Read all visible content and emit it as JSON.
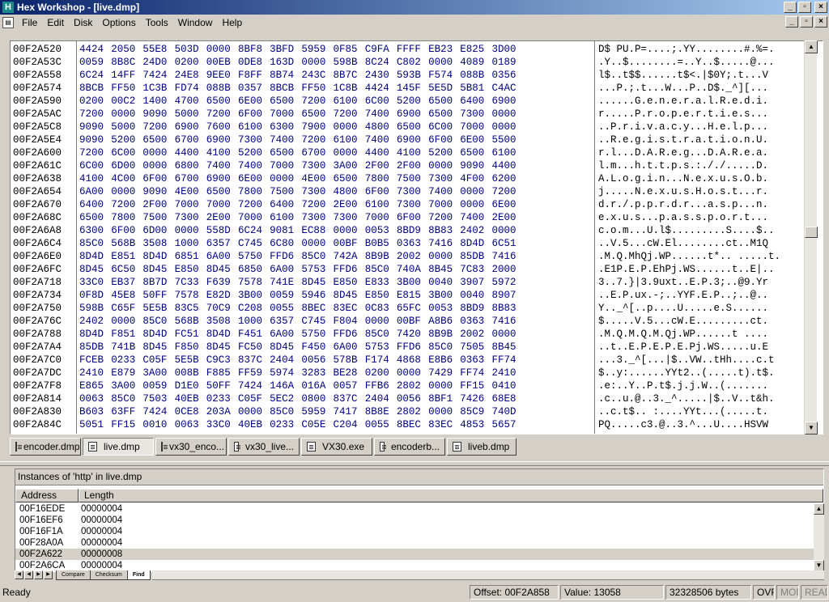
{
  "window": {
    "title": "Hex Workshop - [live.dmp]",
    "app_icon_letter": "H",
    "buttons": {
      "minimize": "_",
      "maximize": "▫",
      "close": "×"
    }
  },
  "menu": {
    "items": [
      "File",
      "Edit",
      "Disk",
      "Options",
      "Tools",
      "Window",
      "Help"
    ]
  },
  "hex_view": {
    "rows": [
      {
        "addr": "00F2A520",
        "hex": [
          "4424",
          "2050",
          "55E8",
          "503D",
          "0000",
          "8BF8",
          "3BFD",
          "5959",
          "0F85",
          "C9FA",
          "FFFF",
          "EB23",
          "E825",
          "3D00"
        ],
        "ascii": "D$ PU.P=....;.YY........#.%=."
      },
      {
        "addr": "00F2A53C",
        "hex": [
          "0059",
          "8B8C",
          "24D0",
          "0200",
          "00EB",
          "0DE8",
          "163D",
          "0000",
          "598B",
          "8C24",
          "C802",
          "0000",
          "4089",
          "0189"
        ],
        "ascii": ".Y..$........=..Y..$.....@..."
      },
      {
        "addr": "00F2A558",
        "hex": [
          "6C24",
          "14FF",
          "7424",
          "24E8",
          "9EE0",
          "F8FF",
          "8B74",
          "243C",
          "8B7C",
          "2430",
          "593B",
          "F574",
          "088B",
          "0356"
        ],
        "ascii": "l$..t$$......t$<.|$0Y;.t...V"
      },
      {
        "addr": "00F2A574",
        "hex": [
          "8BCB",
          "FF50",
          "1C3B",
          "FD74",
          "088B",
          "0357",
          "8BCB",
          "FF50",
          "1C8B",
          "4424",
          "145F",
          "5E5D",
          "5B81",
          "C4AC"
        ],
        "ascii": "...P.;.t...W...P..D$._^][..."
      },
      {
        "addr": "00F2A590",
        "hex": [
          "0200",
          "00C2",
          "1400",
          "4700",
          "6500",
          "6E00",
          "6500",
          "7200",
          "6100",
          "6C00",
          "5200",
          "6500",
          "6400",
          "6900"
        ],
        "ascii": "......G.e.n.e.r.a.l.R.e.d.i."
      },
      {
        "addr": "00F2A5AC",
        "hex": [
          "7200",
          "0000",
          "9090",
          "5000",
          "7200",
          "6F00",
          "7000",
          "6500",
          "7200",
          "7400",
          "6900",
          "6500",
          "7300",
          "0000"
        ],
        "ascii": "r.....P.r.o.p.e.r.t.i.e.s..."
      },
      {
        "addr": "00F2A5C8",
        "hex": [
          "9090",
          "5000",
          "7200",
          "6900",
          "7600",
          "6100",
          "6300",
          "7900",
          "0000",
          "4800",
          "6500",
          "6C00",
          "7000",
          "0000"
        ],
        "ascii": "..P.r.i.v.a.c.y...H.e.l.p..."
      },
      {
        "addr": "00F2A5E4",
        "hex": [
          "9090",
          "5200",
          "6500",
          "6700",
          "6900",
          "7300",
          "7400",
          "7200",
          "6100",
          "7400",
          "6900",
          "6F00",
          "6E00",
          "5500"
        ],
        "ascii": "..R.e.g.i.s.t.r.a.t.i.o.n.U."
      },
      {
        "addr": "00F2A600",
        "hex": [
          "7200",
          "6C00",
          "0000",
          "4400",
          "4100",
          "5200",
          "6500",
          "6700",
          "0000",
          "4400",
          "4100",
          "5200",
          "6500",
          "6100"
        ],
        "ascii": "r.l...D.A.R.e.g...D.A.R.e.a."
      },
      {
        "addr": "00F2A61C",
        "hex": [
          "6C00",
          "6D00",
          "0000",
          "6800",
          "7400",
          "7400",
          "7000",
          "7300",
          "3A00",
          "2F00",
          "2F00",
          "0000",
          "9090",
          "4400"
        ],
        "ascii": "l.m...h.t.t.p.s.:././.....D."
      },
      {
        "addr": "00F2A638",
        "hex": [
          "4100",
          "4C00",
          "6F00",
          "6700",
          "6900",
          "6E00",
          "0000",
          "4E00",
          "6500",
          "7800",
          "7500",
          "7300",
          "4F00",
          "6200"
        ],
        "ascii": "A.L.o.g.i.n...N.e.x.u.s.O.b."
      },
      {
        "addr": "00F2A654",
        "hex": [
          "6A00",
          "0000",
          "9090",
          "4E00",
          "6500",
          "7800",
          "7500",
          "7300",
          "4800",
          "6F00",
          "7300",
          "7400",
          "0000",
          "7200"
        ],
        "ascii": "j.....N.e.x.u.s.H.o.s.t...r."
      },
      {
        "addr": "00F2A670",
        "hex": [
          "6400",
          "7200",
          "2F00",
          "7000",
          "7000",
          "7200",
          "6400",
          "7200",
          "2E00",
          "6100",
          "7300",
          "7000",
          "0000",
          "6E00"
        ],
        "ascii": "d.r./.p.p.r.d.r...a.s.p...n."
      },
      {
        "addr": "00F2A68C",
        "hex": [
          "6500",
          "7800",
          "7500",
          "7300",
          "2E00",
          "7000",
          "6100",
          "7300",
          "7300",
          "7000",
          "6F00",
          "7200",
          "7400",
          "2E00"
        ],
        "ascii": "e.x.u.s...p.a.s.s.p.o.r.t..."
      },
      {
        "addr": "00F2A6A8",
        "hex": [
          "6300",
          "6F00",
          "6D00",
          "0000",
          "558D",
          "6C24",
          "9081",
          "EC88",
          "0000",
          "0053",
          "8BD9",
          "8B83",
          "2402",
          "0000"
        ],
        "ascii": "c.o.m...U.l$.........S....$.."
      },
      {
        "addr": "00F2A6C4",
        "hex": [
          "85C0",
          "568B",
          "3508",
          "1000",
          "6357",
          "C745",
          "6C80",
          "0000",
          "00BF",
          "B0B5",
          "0363",
          "7416",
          "8D4D",
          "6C51"
        ],
        "ascii": "..V.5...cW.El........ct..M1Q"
      },
      {
        "addr": "00F2A6E0",
        "hex": [
          "8D4D",
          "E851",
          "8D4D",
          "6851",
          "6A00",
          "5750",
          "FFD6",
          "85C0",
          "742A",
          "8B9B",
          "2002",
          "0000",
          "85DB",
          "7416"
        ],
        "ascii": ".M.Q.MhQj.WP......t*.. .....t."
      },
      {
        "addr": "00F2A6FC",
        "hex": [
          "8D45",
          "6C50",
          "8D45",
          "E850",
          "8D45",
          "6850",
          "6A00",
          "5753",
          "FFD6",
          "85C0",
          "740A",
          "8B45",
          "7C83",
          "2000"
        ],
        "ascii": ".E1P.E.P.EhPj.WS......t..E|.. "
      },
      {
        "addr": "00F2A718",
        "hex": [
          "33C0",
          "EB37",
          "8B7D",
          "7C33",
          "F639",
          "7578",
          "741E",
          "8D45",
          "E850",
          "E833",
          "3B00",
          "0040",
          "3907",
          "5972"
        ],
        "ascii": "3..7.}|3.9uxt..E.P.3;..@9.Yr"
      },
      {
        "addr": "00F2A734",
        "hex": [
          "0F8D",
          "45E8",
          "50FF",
          "7578",
          "E82D",
          "3B00",
          "0059",
          "5946",
          "8D45",
          "E850",
          "E815",
          "3B00",
          "0040",
          "8907"
        ],
        "ascii": "..E.P.ux.-;..YYF.E.P..;..@.."
      },
      {
        "addr": "00F2A750",
        "hex": [
          "598B",
          "C65F",
          "5E5B",
          "83C5",
          "70C9",
          "C208",
          "0055",
          "8BEC",
          "83EC",
          "0C83",
          "65FC",
          "0053",
          "8BD9",
          "8B83"
        ],
        "ascii": "Y.._^[..p....U.....e.S......"
      },
      {
        "addr": "00F2A76C",
        "hex": [
          "2402",
          "0000",
          "85C0",
          "568B",
          "3508",
          "1000",
          "6357",
          "C745",
          "F804",
          "0000",
          "00BF",
          "A8B6",
          "0363",
          "7416"
        ],
        "ascii": "$.....V.5...cW.E.........ct."
      },
      {
        "addr": "00F2A788",
        "hex": [
          "8D4D",
          "F851",
          "8D4D",
          "FC51",
          "8D4D",
          "F451",
          "6A00",
          "5750",
          "FFD6",
          "85C0",
          "7420",
          "8B9B",
          "2002",
          "0000"
        ],
        "ascii": ".M.Q.M.Q.M.Qj.WP......t ...."
      },
      {
        "addr": "00F2A7A4",
        "hex": [
          "85DB",
          "741B",
          "8D45",
          "F850",
          "8D45",
          "FC50",
          "8D45",
          "F450",
          "6A00",
          "5753",
          "FFD6",
          "85C0",
          "7505",
          "8B45"
        ],
        "ascii": "..t..E.P.E.P.E.Pj.WS.....u.E"
      },
      {
        "addr": "00F2A7C0",
        "hex": [
          "FCEB",
          "0233",
          "C05F",
          "5E5B",
          "C9C3",
          "837C",
          "2404",
          "0056",
          "578B",
          "F174",
          "4868",
          "E8B6",
          "0363",
          "FF74"
        ],
        "ascii": "...3._^[...|$..VW..tHh....c.t"
      },
      {
        "addr": "00F2A7DC",
        "hex": [
          "2410",
          "E879",
          "3A00",
          "008B",
          "F885",
          "FF59",
          "5974",
          "3283",
          "BE28",
          "0200",
          "0000",
          "7429",
          "FF74",
          "2410"
        ],
        "ascii": "$..y:......YYt2..(.....t).t$."
      },
      {
        "addr": "00F2A7F8",
        "hex": [
          "E865",
          "3A00",
          "0059",
          "D1E0",
          "50FF",
          "7424",
          "146A",
          "016A",
          "0057",
          "FFB6",
          "2802",
          "0000",
          "FF15",
          "0410"
        ],
        "ascii": ".e:..Y..P.t$.j.j.W..(......."
      },
      {
        "addr": "00F2A814",
        "hex": [
          "0063",
          "85C0",
          "7503",
          "40EB",
          "0233",
          "C05F",
          "5EC2",
          "0800",
          "837C",
          "2404",
          "0056",
          "8BF1",
          "7426",
          "68E8"
        ],
        "ascii": ".c..u.@..3._^.....|$..V..t&h."
      },
      {
        "addr": "00F2A830",
        "hex": [
          "B603",
          "63FF",
          "7424",
          "0CE8",
          "203A",
          "0000",
          "85C0",
          "5959",
          "7417",
          "8B8E",
          "2802",
          "0000",
          "85C9",
          "740D"
        ],
        "ascii": "..c.t$.. :....YYt...(.....t."
      },
      {
        "addr": "00F2A84C",
        "hex": [
          "5051",
          "FF15",
          "0010",
          "0063",
          "33C0",
          "40EB",
          "0233",
          "C05E",
          "C204",
          "0055",
          "8BEC",
          "83EC",
          "4853",
          "5657"
        ],
        "ascii": "PQ.....c3.@..3.^...U....HSVW"
      }
    ]
  },
  "doc_tabs": [
    {
      "label": "encoder.dmp",
      "active": false
    },
    {
      "label": "live.dmp",
      "active": true
    },
    {
      "label": "vx30_enco...",
      "active": false
    },
    {
      "label": "vx30_live...",
      "active": false
    },
    {
      "label": "VX30.exe",
      "active": false
    },
    {
      "label": "encoderb...",
      "active": false
    },
    {
      "label": "liveb.dmp",
      "active": false
    }
  ],
  "find_panel": {
    "caption": "Instances of 'http' in live.dmp",
    "columns": [
      "Address",
      "Length"
    ],
    "rows": [
      {
        "address": "00F16EDE",
        "length": "00000004",
        "selected": false
      },
      {
        "address": "00F16EF6",
        "length": "00000004",
        "selected": false
      },
      {
        "address": "00F16F1A",
        "length": "00000004",
        "selected": false
      },
      {
        "address": "00F28A0A",
        "length": "00000004",
        "selected": false
      },
      {
        "address": "00F2A622",
        "length": "00000008",
        "selected": true
      },
      {
        "address": "00F2A6CA",
        "length": "00000004",
        "selected": false
      }
    ]
  },
  "sheet_tabs": [
    {
      "label": "Compare",
      "active": false
    },
    {
      "label": "Checksum",
      "active": false
    },
    {
      "label": "Find",
      "active": true
    }
  ],
  "status": {
    "ready": "Ready",
    "offset": "Offset: 00F2A858",
    "value": "Value: 13058",
    "size": "32328506 bytes",
    "ovr": "OVR",
    "mod": "MOD",
    "read": "READ"
  }
}
